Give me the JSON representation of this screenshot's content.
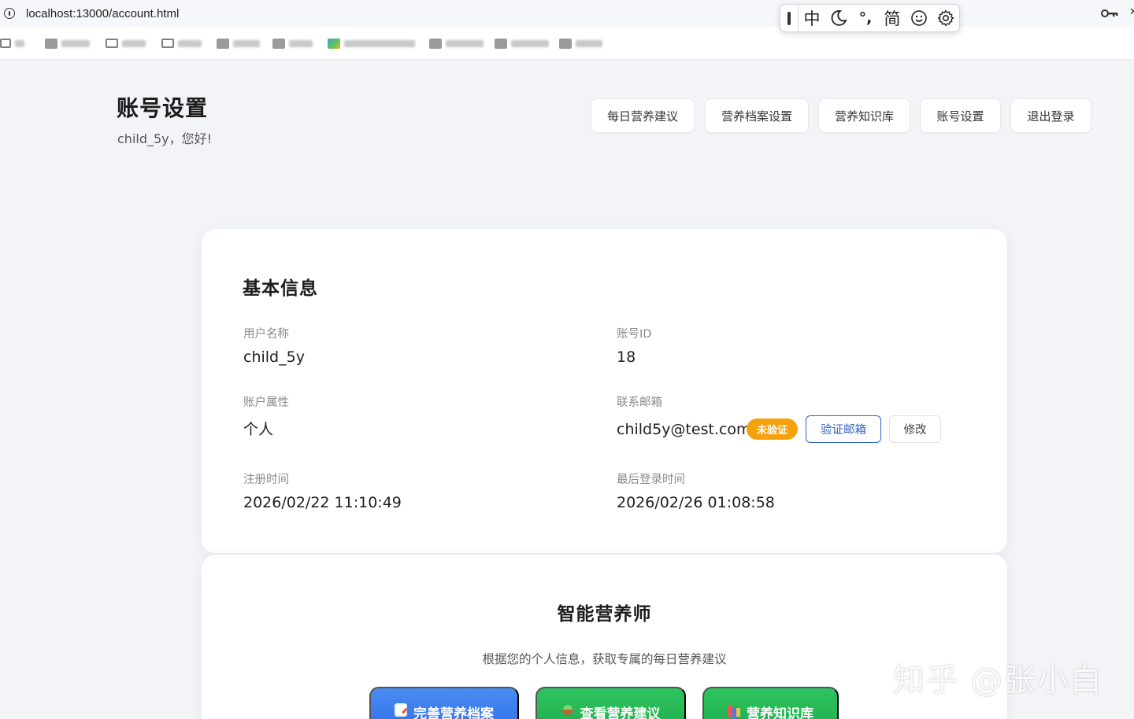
{
  "browser": {
    "url": "localhost:13000/account.html"
  },
  "ime_toolbar": {
    "mode": "中",
    "punct": "°,",
    "charset": "简"
  },
  "header": {
    "title": "账号设置",
    "greeting": "child_5y，您好!"
  },
  "nav": [
    {
      "label": "每日营养建议"
    },
    {
      "label": "营养档案设置"
    },
    {
      "label": "营养知识库"
    },
    {
      "label": "账号设置"
    },
    {
      "label": "退出登录"
    }
  ],
  "basic_info": {
    "title": "基本信息",
    "username_label": "用户名称",
    "username": "child_5y",
    "account_id_label": "账号ID",
    "account_id": "18",
    "account_type_label": "账户属性",
    "account_type": "个人",
    "email_label": "联系邮箱",
    "email": "child5y@test.com",
    "email_status": "未验证",
    "verify_button": "验证邮箱",
    "edit_button": "修改",
    "register_time_label": "注册时间",
    "register_time": "2026/02/22 11:10:49",
    "last_login_label": "最后登录时间",
    "last_login": "2026/02/26 01:08:58"
  },
  "assistant": {
    "title": "智能营养师",
    "subtitle": "根据您的个人信息，获取专属的每日营养建议",
    "actions": [
      {
        "label": "完善营养档案",
        "icon": "document-edit-icon",
        "color": "#3b7fee"
      },
      {
        "label": "查看营养建议",
        "icon": "salad-bowl-icon",
        "color": "#22b854"
      },
      {
        "label": "营养知识库",
        "icon": "books-icon",
        "color": "#22b854"
      }
    ]
  },
  "watermark": "知乎 @张小白",
  "colors": {
    "accent": "#2f63c4",
    "badge_warning": "#f5a10c",
    "button_blue": "#3b7fee",
    "button_green": "#22b854"
  }
}
